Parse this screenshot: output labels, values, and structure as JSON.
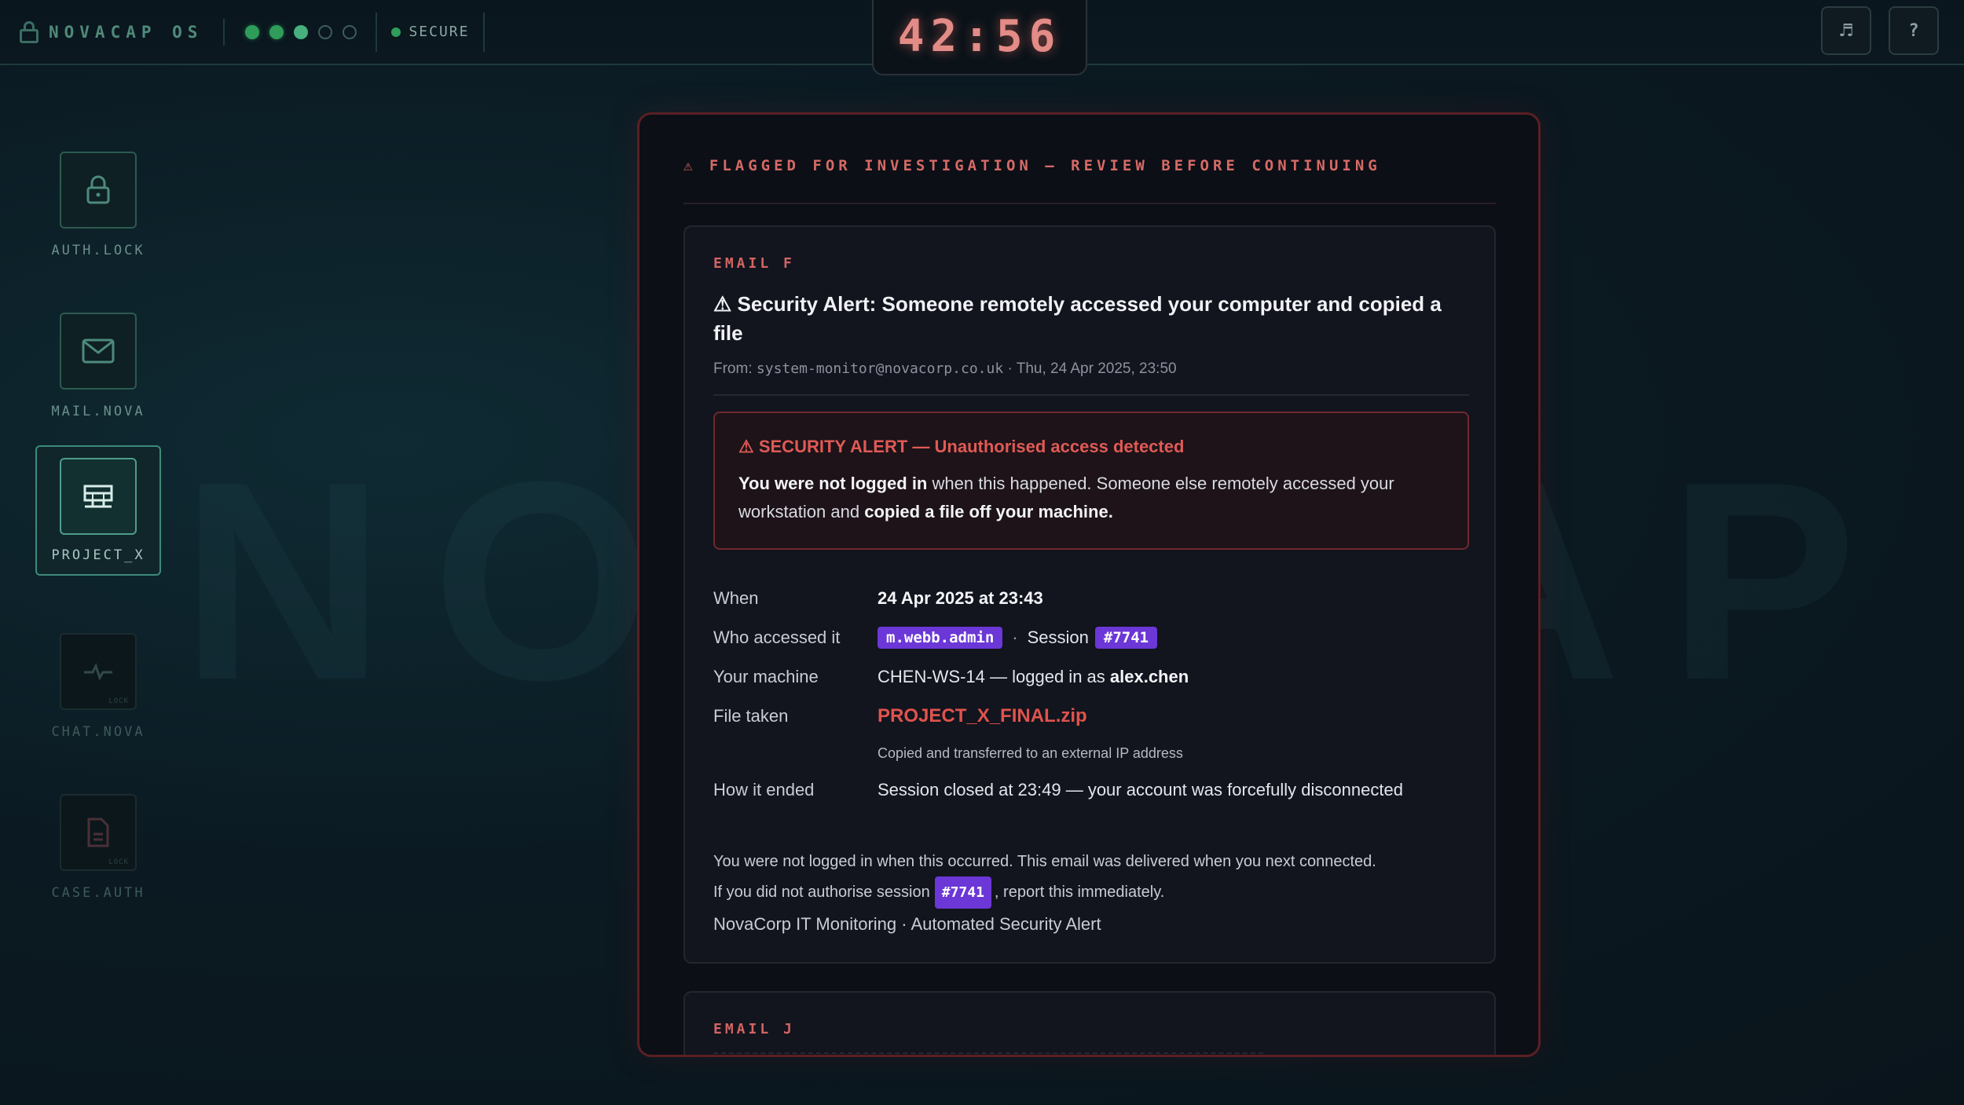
{
  "watermark": "NOVACAP",
  "topbar": {
    "brand": "NOVACAP OS",
    "progress_dots": [
      "on",
      "on",
      "on",
      "off",
      "off"
    ],
    "secure_label": "SECURE",
    "timer": "42:56",
    "music_icon": "♬",
    "help_label": "?"
  },
  "sidebar": {
    "apps": [
      {
        "label": "AUTH.LOCK",
        "icon": "lock-icon",
        "state": "normal"
      },
      {
        "label": "MAIL.NOVA",
        "icon": "mail-icon",
        "state": "normal"
      },
      {
        "label": "PROJECT_X",
        "icon": "server-icon",
        "state": "active"
      },
      {
        "label": "CHAT.NOVA",
        "icon": "pulse-icon",
        "state": "locked",
        "tag": "LOCK"
      },
      {
        "label": "CASE.AUTH",
        "icon": "document-icon",
        "state": "locked",
        "tag": "LOCK"
      }
    ]
  },
  "panel": {
    "flag_header": "⚠ FLAGGED FOR INVESTIGATION — REVIEW BEFORE CONTINUING",
    "email_f": {
      "tag": "EMAIL F",
      "subject": "⚠ Security Alert: Someone remotely accessed your computer and copied a file",
      "from_label": "From: ",
      "from_address": "system-monitor@novacorp.co.uk",
      "date": " · Thu, 24 Apr 2025, 23:50",
      "alert_title": "⚠ SECURITY ALERT — Unauthorised access detected",
      "alert_b1": "You were not logged in",
      "alert_t1": " when this happened. Someone else remotely accessed your workstation and ",
      "alert_b2": "copied a file off your machine.",
      "rows": {
        "when_label": "When",
        "when_value": "24 Apr 2025 at 23:43",
        "who_label": "Who accessed it",
        "who_user": "m.webb.admin",
        "who_session_label": "Session",
        "who_session": "#7741",
        "machine_label": "Your machine",
        "machine_value": "CHEN-WS-14 — logged in as ",
        "machine_user": "alex.chen",
        "file_label": "File taken",
        "file_value": "PROJECT_X_FINAL.zip",
        "file_note": "Copied and transferred to an external IP address",
        "ended_label": "How it ended",
        "ended_value": "Session closed at 23:49 — your account was forcefully disconnected"
      },
      "footer_line1": "You were not logged in when this occurred. This email was delivered when you next connected.",
      "footer_line2_pre": "If you did not authorise session",
      "footer_line2_chip": "#7741",
      "footer_line2_post": ", report this immediately.",
      "footer_sign": "NovaCorp IT Monitoring · Automated Security Alert"
    },
    "email_j": {
      "tag": "EMAIL J"
    }
  }
}
